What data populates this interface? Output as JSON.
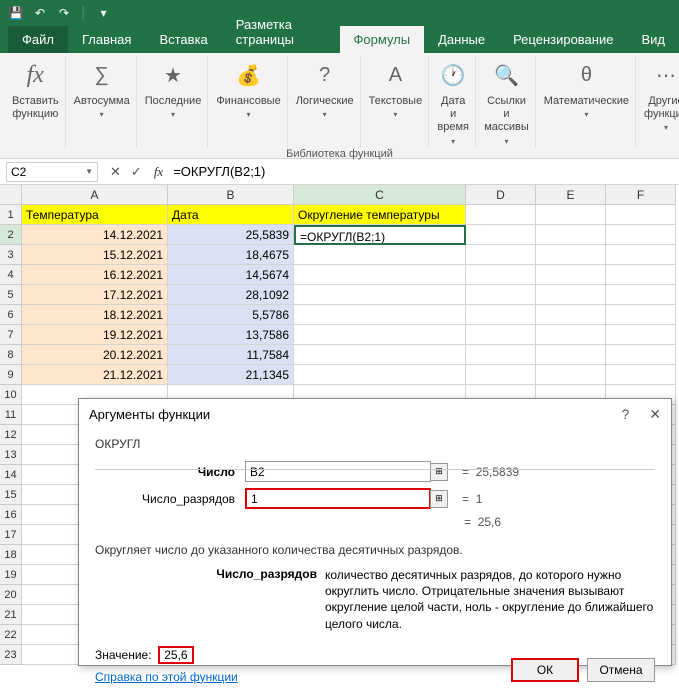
{
  "qat": {
    "save": "💾",
    "undo": "↶",
    "redo": "↷"
  },
  "tabs": {
    "file": "Файл",
    "home": "Главная",
    "insert": "Вставка",
    "layout": "Разметка страницы",
    "formulas": "Формулы",
    "data": "Данные",
    "review": "Рецензирование",
    "view": "Вид"
  },
  "ribbon": {
    "insert_fn": "Вставить функцию",
    "autosum": "Автосумма",
    "recent": "Последние",
    "financial": "Финансовые",
    "logical": "Логические",
    "text": "Текстовые",
    "datetime": "Дата и время",
    "lookup": "Ссылки и массивы",
    "math": "Математические",
    "more": "Другие функции",
    "caption": "Библиотека функций"
  },
  "namebox": "C2",
  "fx_symbols": {
    "cancel": "✕",
    "ok": "✓"
  },
  "fx_label": "fx",
  "formula": "=ОКРУГЛ(B2;1)",
  "columns": [
    "A",
    "B",
    "C",
    "D",
    "E",
    "F"
  ],
  "headers": {
    "a": "Температура",
    "b": "Дата",
    "c": "Округление температуры"
  },
  "active_cell_display": "=ОКРУГЛ(B2;1)",
  "table_rows": [
    {
      "r": "2",
      "a": "14.12.2021",
      "b": "25,5839"
    },
    {
      "r": "3",
      "a": "15.12.2021",
      "b": "18,4675"
    },
    {
      "r": "4",
      "a": "16.12.2021",
      "b": "14,5674"
    },
    {
      "r": "5",
      "a": "17.12.2021",
      "b": "28,1092"
    },
    {
      "r": "6",
      "a": "18.12.2021",
      "b": "5,5786"
    },
    {
      "r": "7",
      "a": "19.12.2021",
      "b": "13,7586"
    },
    {
      "r": "8",
      "a": "20.12.2021",
      "b": "11,7584"
    },
    {
      "r": "9",
      "a": "21.12.2021",
      "b": "21,1345"
    }
  ],
  "empty_rows": [
    "10",
    "11",
    "12",
    "13",
    "14",
    "15",
    "16",
    "17",
    "18",
    "19",
    "20",
    "21",
    "22",
    "23"
  ],
  "dialog": {
    "title": "Аргументы функции",
    "help": "?",
    "close": "✕",
    "fn": "ОКРУГЛ",
    "arg1_label": "Число",
    "arg1_val": "B2",
    "arg1_res": "25,5839",
    "arg2_label": "Число_разрядов",
    "arg2_val": "1",
    "arg2_res": "1",
    "preview": "25,6",
    "desc": "Округляет число до указанного количества десятичных разрядов.",
    "param_name": "Число_разрядов",
    "param_desc": "количество десятичных разрядов, до которого нужно округлить число. Отрицательные значения вызывают округление целой части, ноль - округление до ближайшего целого числа.",
    "result_label": "Значение:",
    "result_val": "25,6",
    "help_link": "Справка по этой функции",
    "ok": "ОК",
    "cancel": "Отмена",
    "eq": "="
  }
}
